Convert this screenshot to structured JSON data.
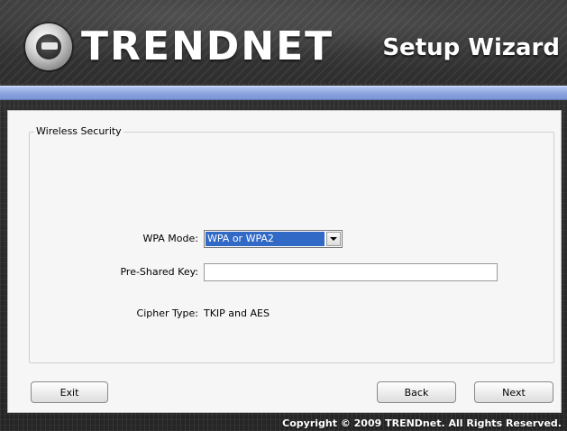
{
  "header": {
    "brand": "TRENDNET",
    "title": "Setup Wizard"
  },
  "section": {
    "legend": "Wireless Security"
  },
  "form": {
    "wpa_mode_label": "WPA Mode:",
    "wpa_mode_value": "WPA or WPA2",
    "psk_label": "Pre-Shared Key:",
    "psk_value": "",
    "cipher_label": "Cipher Type:",
    "cipher_value": "TKIP and AES"
  },
  "buttons": {
    "exit": "Exit",
    "back": "Back",
    "next": "Next"
  },
  "footer": {
    "copyright": "Copyright © 2009 TRENDnet. All Rights Reserved."
  },
  "colors": {
    "accent_bar": "#8ea6e0",
    "selection": "#3169c6"
  }
}
